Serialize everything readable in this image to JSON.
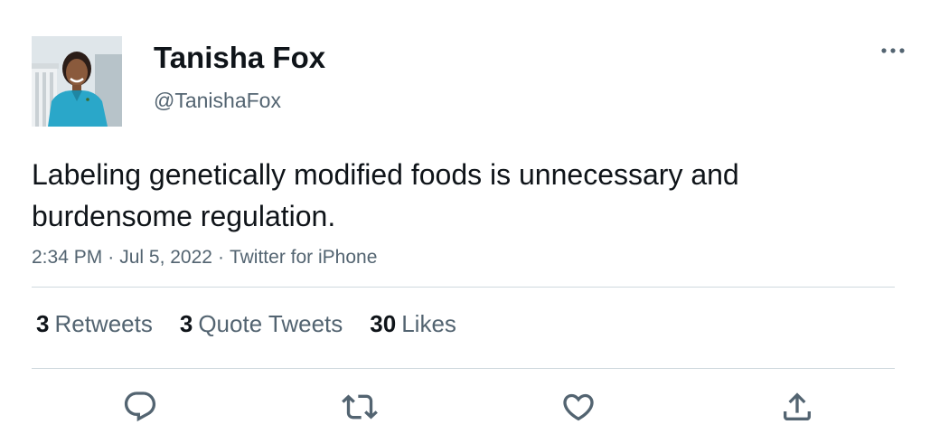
{
  "tweet": {
    "display_name": "Tanisha Fox",
    "handle": "@TanishaFox",
    "text": "Labeling genetically modified foods is unnecessary and burdensome regulation.",
    "time": "2:34 PM",
    "date": "Jul 5, 2022",
    "separator": "·",
    "source": "Twitter for iPhone"
  },
  "stats": {
    "retweets_count": "3",
    "retweets_label": "Retweets",
    "quotes_count": "3",
    "quotes_label": "Quote Tweets",
    "likes_count": "30",
    "likes_label": "Likes"
  },
  "icons": {
    "more": "more-horizontal-icon",
    "reply": "reply-icon",
    "retweet": "retweet-icon",
    "like": "heart-icon",
    "share": "share-icon"
  },
  "colors": {
    "text_primary": "#0f1419",
    "text_secondary": "#536471",
    "divider": "#cfd9de",
    "avatar_jacket": "#2aa7c9"
  }
}
